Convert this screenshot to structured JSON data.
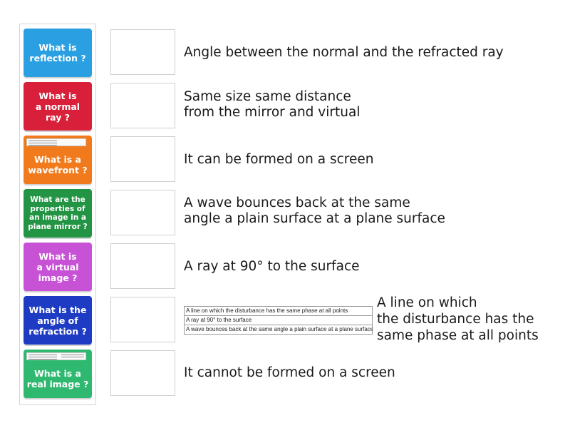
{
  "questions": [
    {
      "label": "What is\nreflection ?",
      "color": "#2a9fe2"
    },
    {
      "label": "What is\na normal\nray ?",
      "color": "#d8203a"
    },
    {
      "label": "What is a\nwavefront ?",
      "color": "#f07a1c"
    },
    {
      "label": "What are the\nproperties of\nan image in a\nplane mirror ?",
      "color": "#239443"
    },
    {
      "label": "What is\na virtual\nimage ?",
      "color": "#c752d6"
    },
    {
      "label": "What is the\nangle of\nrefraction ?",
      "color": "#1e3bc4"
    },
    {
      "label": "What is a\nreal image ?",
      "color": "#2fb870"
    }
  ],
  "answers": [
    {
      "text": "Angle between the normal and the refracted ray"
    },
    {
      "text": "Same size same distance\nfrom the mirror and virtual"
    },
    {
      "text": "It can be formed on a screen"
    },
    {
      "text": "A wave bounces back at the same\nangle a plain surface at a plane surface"
    },
    {
      "text": "A ray at 90° to the surface"
    },
    {
      "image_rows": [
        "A line on which the disturbance has the same phase at all points",
        "A ray at 90° to the surface",
        "A wave bounces back at the same angle a plain surface at a plane surface"
      ],
      "text": "A line on which\nthe disturbance has the\nsame phase at all points"
    },
    {
      "text": "It cannot be formed on a screen"
    }
  ]
}
